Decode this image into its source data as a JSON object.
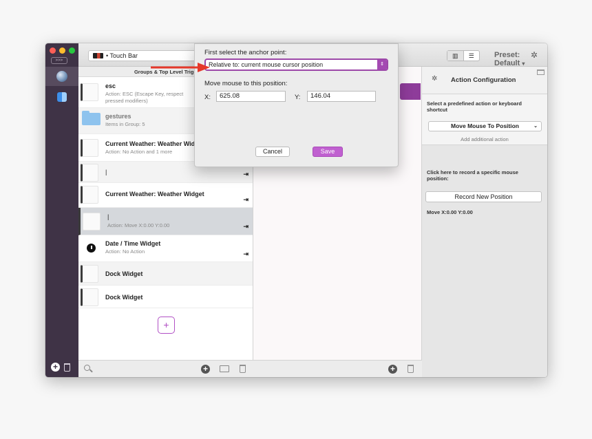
{
  "toolbar": {
    "touchbar_label": "• Touch Bar",
    "preset_label": "Preset: Default",
    "preset_caret": "▾",
    "expand_label": ">>>"
  },
  "groups": {
    "header": "Groups & Top Level Trigg",
    "rows": [
      {
        "title": "esc",
        "sub": "Action: ESC (Escape Key, respect",
        "sub2": "pressed modifiers)"
      },
      {
        "title": "gestures",
        "sub": "Items in Group: 5"
      },
      {
        "title": "Current Weather: Weather Wid",
        "sub": "Action: No Action and 1 more"
      },
      {
        "title": "|",
        "sub": ""
      },
      {
        "title": "Current Weather: Weather Widget",
        "sub": ""
      },
      {
        "title": "|",
        "sub": "Action: Move X:0.00 Y:0.00"
      },
      {
        "title": "Date / Time Widget",
        "sub": "Action: No Action"
      },
      {
        "title": "Dock Widget",
        "sub": ""
      },
      {
        "title": "Dock Widget",
        "sub": ""
      }
    ],
    "add_label": "+"
  },
  "dialog": {
    "anchor_label": "First select the anchor point:",
    "anchor_value": "Relative to: current mouse cursor position",
    "move_label": "Move mouse to this position:",
    "x_label": "X:",
    "x_value": "625.08",
    "y_label": "Y:",
    "y_value": "146.04",
    "cancel_label": "Cancel",
    "save_label": "Save"
  },
  "action_config": {
    "title": "Action Configuration",
    "select_label": "Select a predefined action or keyboard shortcut",
    "selected_action": "Move Mouse To Position",
    "add_additional": "Add additional action",
    "record_label": "Click here to record a specific mouse position:",
    "record_button": "Record New Position",
    "move_readout": "Move X:0.00 Y:0.00"
  },
  "icons": {
    "arrow_icon": "⇥",
    "gear_icon": "✲",
    "chevron_icon": "⌄",
    "stepper_icon": "⇕"
  },
  "colors": {
    "accent_purple": "#a44ab2",
    "save_button": "#c060d0",
    "rail_bg": "#3f3346",
    "annotation_red": "#e5382a"
  }
}
